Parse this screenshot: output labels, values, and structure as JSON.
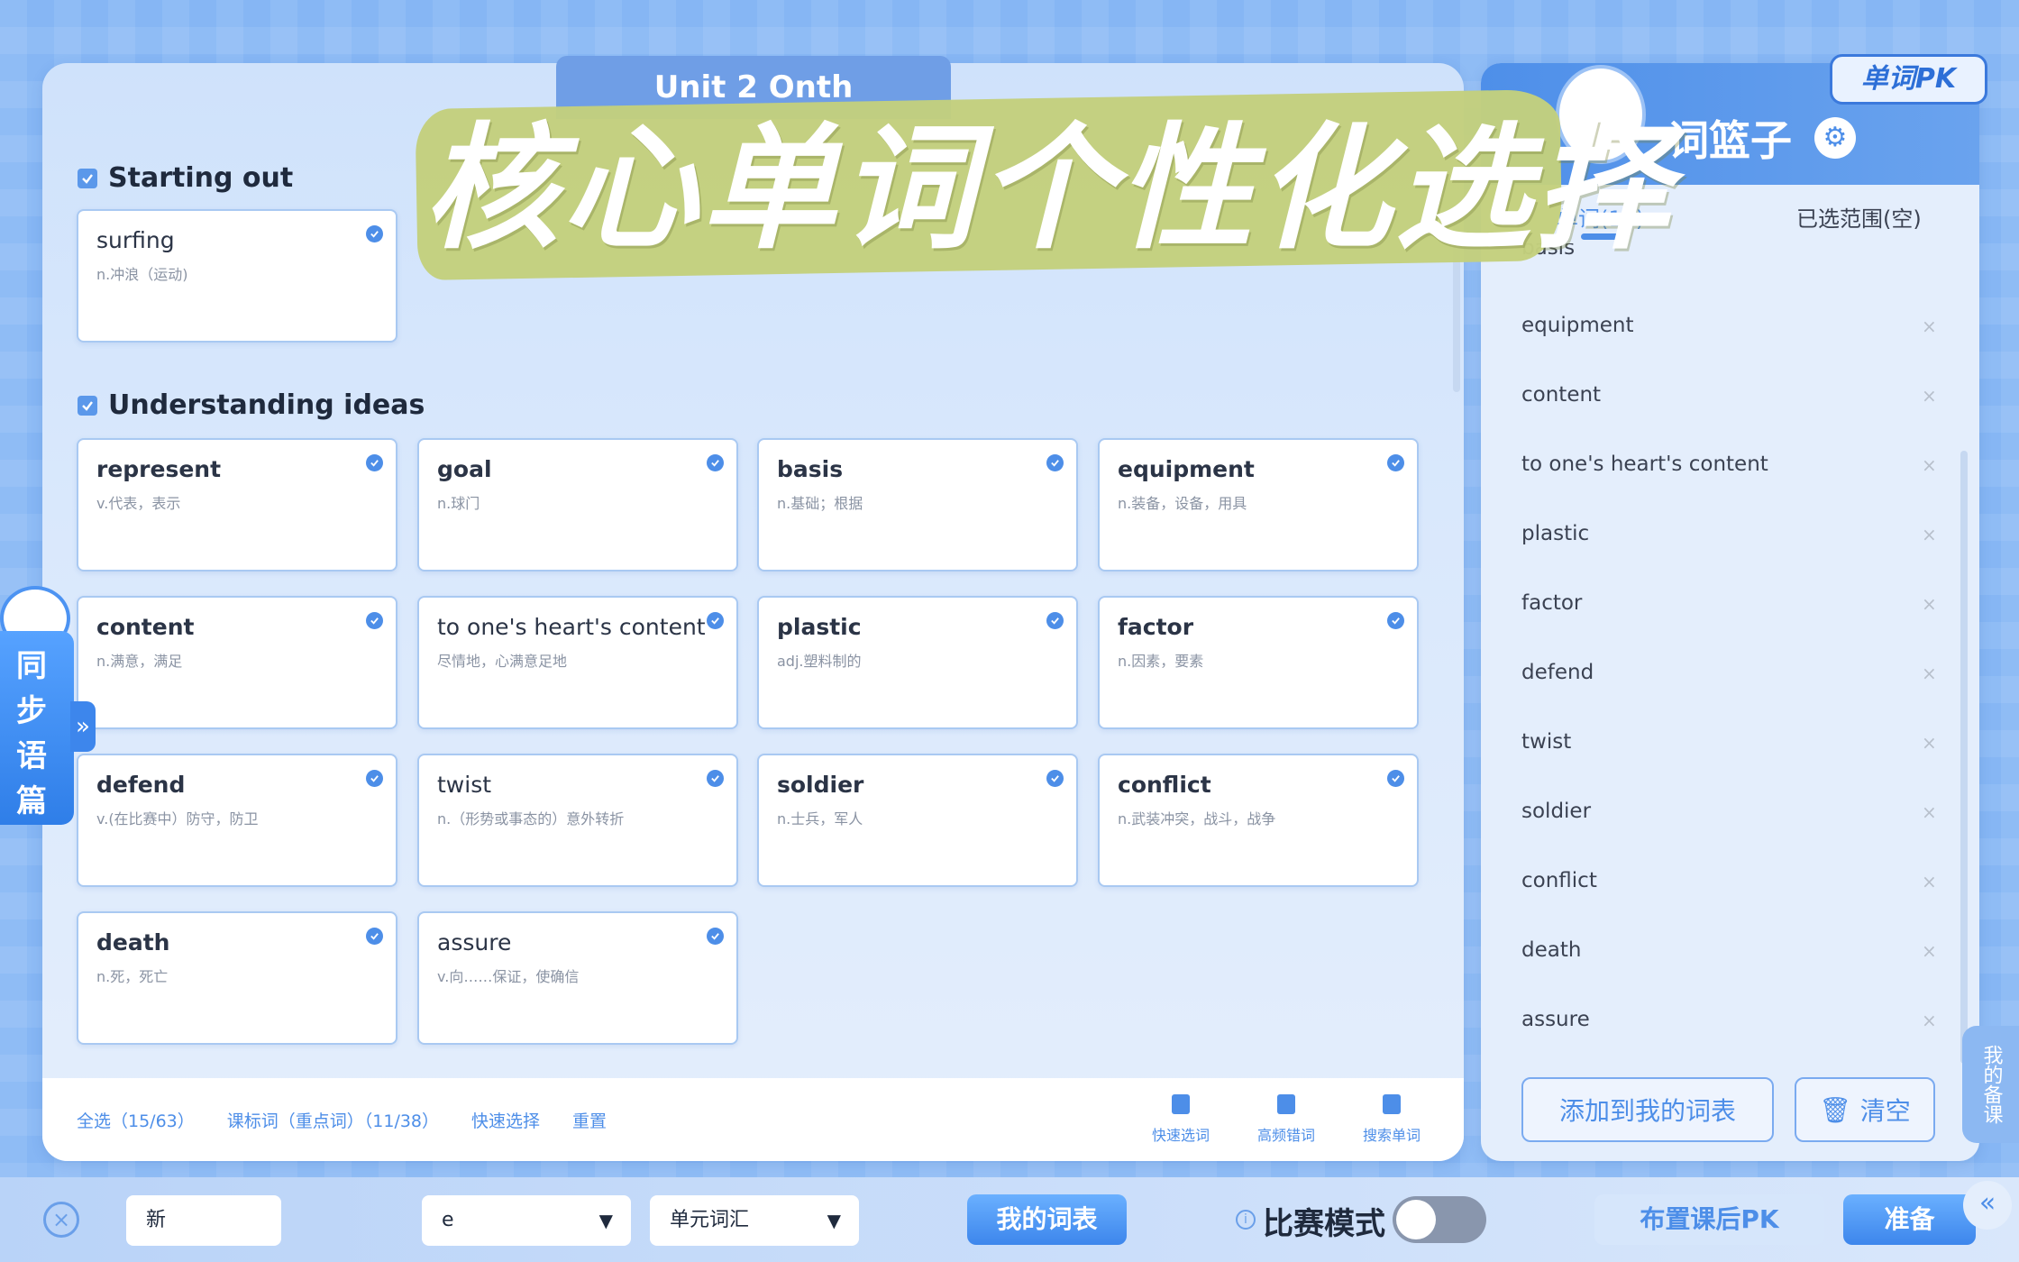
{
  "unit_tab": {
    "label": "Unit 2 Onth"
  },
  "sections": [
    {
      "title": "Starting out",
      "cards": [
        {
          "word": "surfing",
          "def": "n.冲浪（运动)"
        }
      ]
    },
    {
      "title": "Understanding ideas",
      "cards": [
        {
          "word": "represent",
          "def": "v.代表，表示"
        },
        {
          "word": "goal",
          "def": "n.球门"
        },
        {
          "word": "basis",
          "def": "n.基础；根据"
        },
        {
          "word": "equipment",
          "def": "n.装备，设备，用具"
        },
        {
          "word": "content",
          "def": "n.满意，满足"
        },
        {
          "word": "to one's heart's content",
          "def": "尽情地，心满意足地"
        },
        {
          "word": "plastic",
          "def": "adj.塑料制的"
        },
        {
          "word": "factor",
          "def": "n.因素，要素"
        },
        {
          "word": "defend",
          "def": "v.(在比赛中）防守，防卫"
        },
        {
          "word": "twist",
          "def": "n.（形势或事态的）意外转折"
        },
        {
          "word": "soldier",
          "def": "n.士兵，军人"
        },
        {
          "word": "conflict",
          "def": "n.武装冲突，战斗，战争"
        },
        {
          "word": "death",
          "def": "n.死，死亡"
        },
        {
          "word": "assure",
          "def": "v.向……保证，使确信"
        }
      ]
    }
  ],
  "footer": {
    "select_all": "全选（15/63）",
    "curriculum": "课标词（重点词）（11/38）",
    "quick_select": "快速选择",
    "reset": "重置",
    "tools": [
      "快速选词",
      "高频错词",
      "搜索单词"
    ]
  },
  "overlay_title": "核心单词个性化选择",
  "right_panel": {
    "badge": "单词PK",
    "title": "词篮子",
    "tab_words": "单词(15)",
    "tab_range": "已选范围(空)",
    "partial_item": "basis",
    "items": [
      "equipment",
      "content",
      "to one's heart's content",
      "plastic",
      "factor",
      "defend",
      "twist",
      "soldier",
      "conflict",
      "death",
      "assure"
    ],
    "add_btn": "添加到我的词表",
    "clear_btn": "清空",
    "side_tab": "我的备课"
  },
  "left_side_tab": "同步语篇",
  "bottom": {
    "select1": "新",
    "select2": "e",
    "select3": "单元词汇",
    "my_list": "我的词表",
    "mode_label": "比赛模式",
    "assign_pk": "布置课后PK",
    "ready": "准备"
  }
}
